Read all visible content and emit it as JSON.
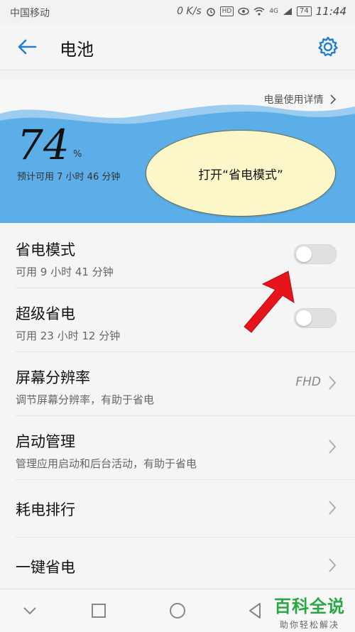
{
  "status_bar": {
    "carrier": "中国移动",
    "net_speed": "0 K/s",
    "hd": "HD",
    "signal": "4G",
    "battery": "74",
    "time": "11:44"
  },
  "app_bar": {
    "title": "电池"
  },
  "hero": {
    "detail_link": "电量使用详情",
    "percent": "74",
    "percent_sign": "%",
    "remaining": "预计可用 7 小时 46 分钟"
  },
  "annotation": {
    "bubble_text": "打开“省电模式”"
  },
  "settings": {
    "items": [
      {
        "label": "省电模式",
        "sub": "可用 9 小时 41 分钟",
        "control": "toggle",
        "enabled": false
      },
      {
        "label": "超级省电",
        "sub": "可用 23 小时 12 分钟",
        "control": "toggle",
        "enabled": false
      },
      {
        "label": "屏幕分辨率",
        "sub": "调节屏幕分辨率，有助于省电",
        "value": "FHD",
        "control": "chevron"
      },
      {
        "label": "启动管理",
        "sub": "管理应用启动和后台活动，有助于省电",
        "control": "chevron"
      },
      {
        "label": "耗电排行",
        "control": "chevron"
      },
      {
        "label": "一键省电",
        "control": "chevron"
      }
    ]
  },
  "watermark": {
    "title": "百科全说",
    "subtitle": "助你轻松解决"
  },
  "colors": {
    "accent": "#1e7fd4",
    "wave": "#5baee8",
    "bubble": "#fbf7c8",
    "arrow": "#e8141b",
    "watermark": "#27a844"
  }
}
